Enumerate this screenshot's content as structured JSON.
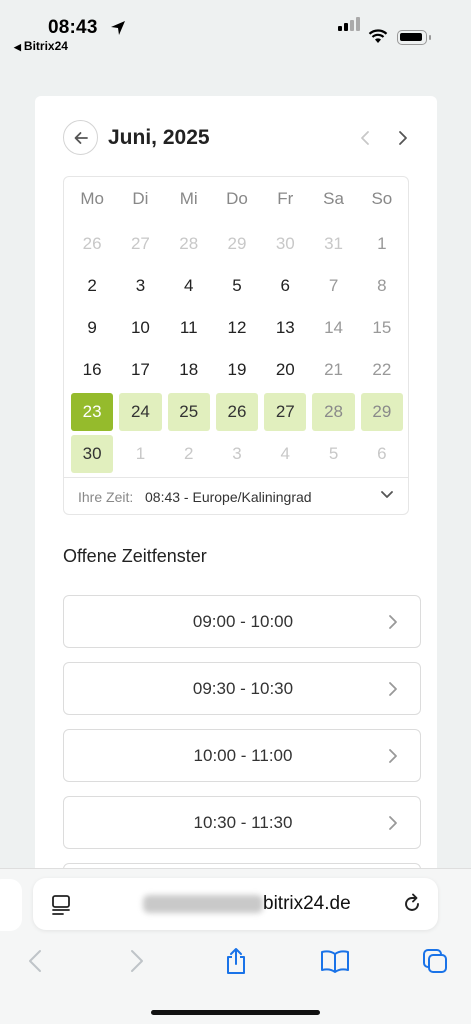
{
  "status": {
    "time": "08:43",
    "back_app": "Bitrix24"
  },
  "calendar": {
    "month_title": "Juni, 2025",
    "weekdays": [
      "Mo",
      "Di",
      "Mi",
      "Do",
      "Fr",
      "Sa",
      "So"
    ],
    "days": [
      "26",
      "27",
      "28",
      "29",
      "30",
      "31",
      "1",
      "2",
      "3",
      "4",
      "5",
      "6",
      "7",
      "8",
      "9",
      "10",
      "11",
      "12",
      "13",
      "14",
      "15",
      "16",
      "17",
      "18",
      "19",
      "20",
      "21",
      "22",
      "23",
      "24",
      "25",
      "26",
      "27",
      "28",
      "29",
      "30",
      "1",
      "2",
      "3",
      "4",
      "5",
      "6"
    ],
    "selected_day": "23",
    "timezone_label": "Ihre Zeit:",
    "timezone_value": "08:43 - Europe/Kaliningrad"
  },
  "slots": {
    "title": "Offene Zeitfenster",
    "items": [
      "09:00 - 10:00",
      "09:30 - 10:30",
      "10:00 - 11:00",
      "10:30 - 11:30"
    ]
  },
  "browser": {
    "url_domain": "bitrix24.de"
  },
  "colors": {
    "selected": "#95bb2c",
    "available": "#e1efbe",
    "accent_blue": "#1a73e8"
  },
  "icons": [
    "location-arrow-icon",
    "back-arrow-icon",
    "chevron-left-icon",
    "chevron-right-icon",
    "chevron-down-icon",
    "reader-icon",
    "reload-icon",
    "share-icon",
    "bookmarks-icon",
    "tabs-icon"
  ]
}
